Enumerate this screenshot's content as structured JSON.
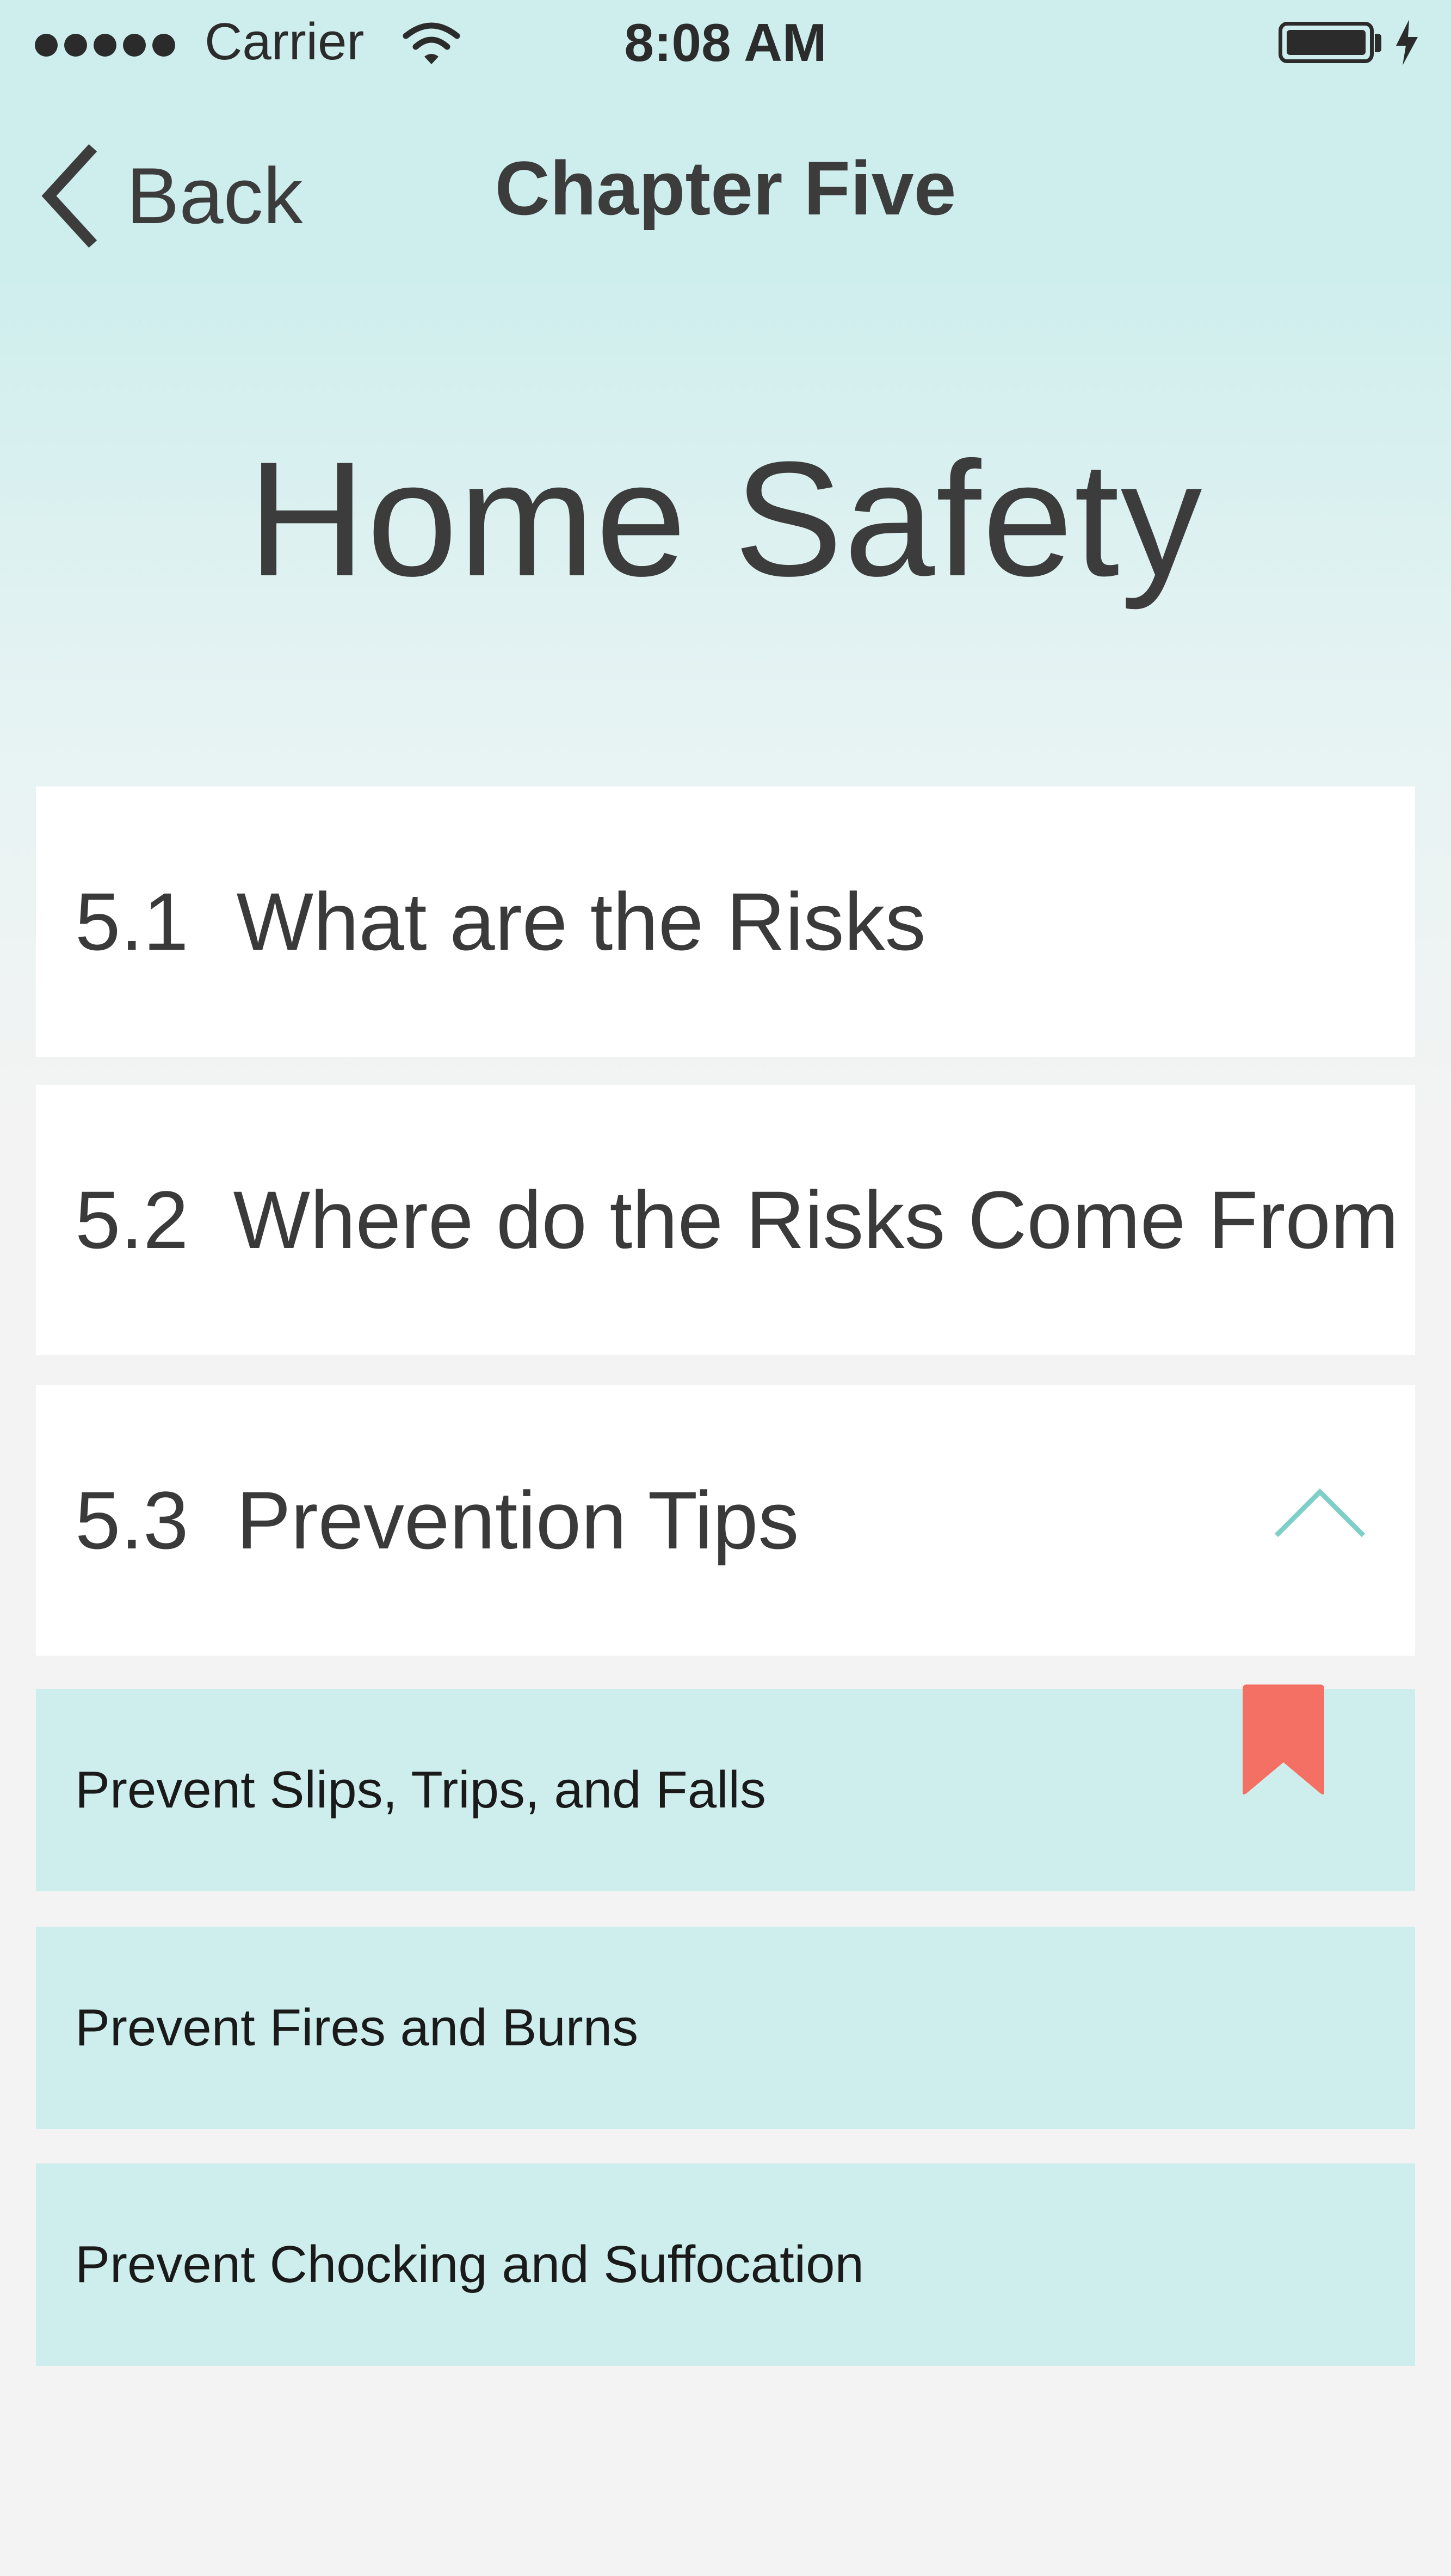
{
  "status_bar": {
    "carrier": "Carrier",
    "time": "8:08 AM",
    "signal_bars": 5,
    "icons": [
      "wifi-icon",
      "battery-icon",
      "charging-bolt-icon"
    ]
  },
  "nav": {
    "back_label": "Back",
    "title": "Chapter Five"
  },
  "page": {
    "title": "Home Safety"
  },
  "sections": [
    {
      "number": "5.1",
      "label": "What are the Risks"
    },
    {
      "number": "5.2",
      "label": "Where do the Risks Come From"
    },
    {
      "number": "5.3",
      "label": "Prevention Tips",
      "expanded": true
    }
  ],
  "sub_items": [
    {
      "label": "Prevent Slips, Trips, and Falls",
      "bookmarked": true
    },
    {
      "label": "Prevent Fires and Burns"
    },
    {
      "label": "Prevent Chocking and Suffocation"
    }
  ],
  "colors": {
    "accent_teal": "#7fcfc9",
    "sub_item_bg": "#ceeeed",
    "bookmark": "#f47064",
    "text": "#3c3c3c"
  }
}
